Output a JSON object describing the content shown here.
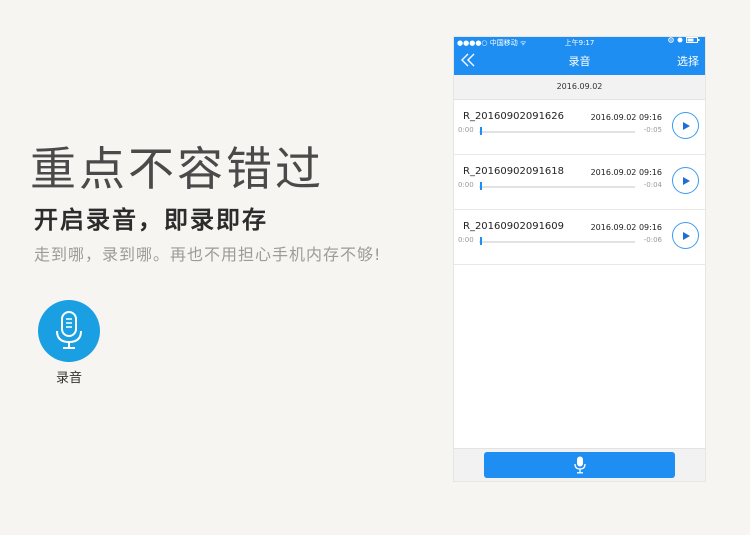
{
  "promo": {
    "headline": "重点不容错过",
    "subhead": "开启录音，即录即存",
    "description": "走到哪，录到哪。再也不用担心手机内存不够!",
    "app_icon_label": "录音"
  },
  "statusbar": {
    "carrier": "●●●●○ 中国移动 ᯤ",
    "time": "上午9:17"
  },
  "navbar": {
    "back_icon": "double-chevron-left-icon",
    "title": "录音",
    "select_label": "选择"
  },
  "list": {
    "date_header": "2016.09.02",
    "recordings": [
      {
        "name": "R_20160902091626",
        "timestamp": "2016.09.02 09:16",
        "elapsed": "0:00",
        "remaining": "-0:05",
        "progress": 0.0
      },
      {
        "name": "R_20160902091618",
        "timestamp": "2016.09.02 09:16",
        "elapsed": "0:00",
        "remaining": "-0:04",
        "progress": 0.0
      },
      {
        "name": "R_20160902091609",
        "timestamp": "2016.09.02 09:16",
        "elapsed": "0:00",
        "remaining": "-0:06",
        "progress": 0.0
      }
    ]
  },
  "colors": {
    "accent": "#1e8ef2",
    "icon_bg": "#1aa0e2"
  }
}
